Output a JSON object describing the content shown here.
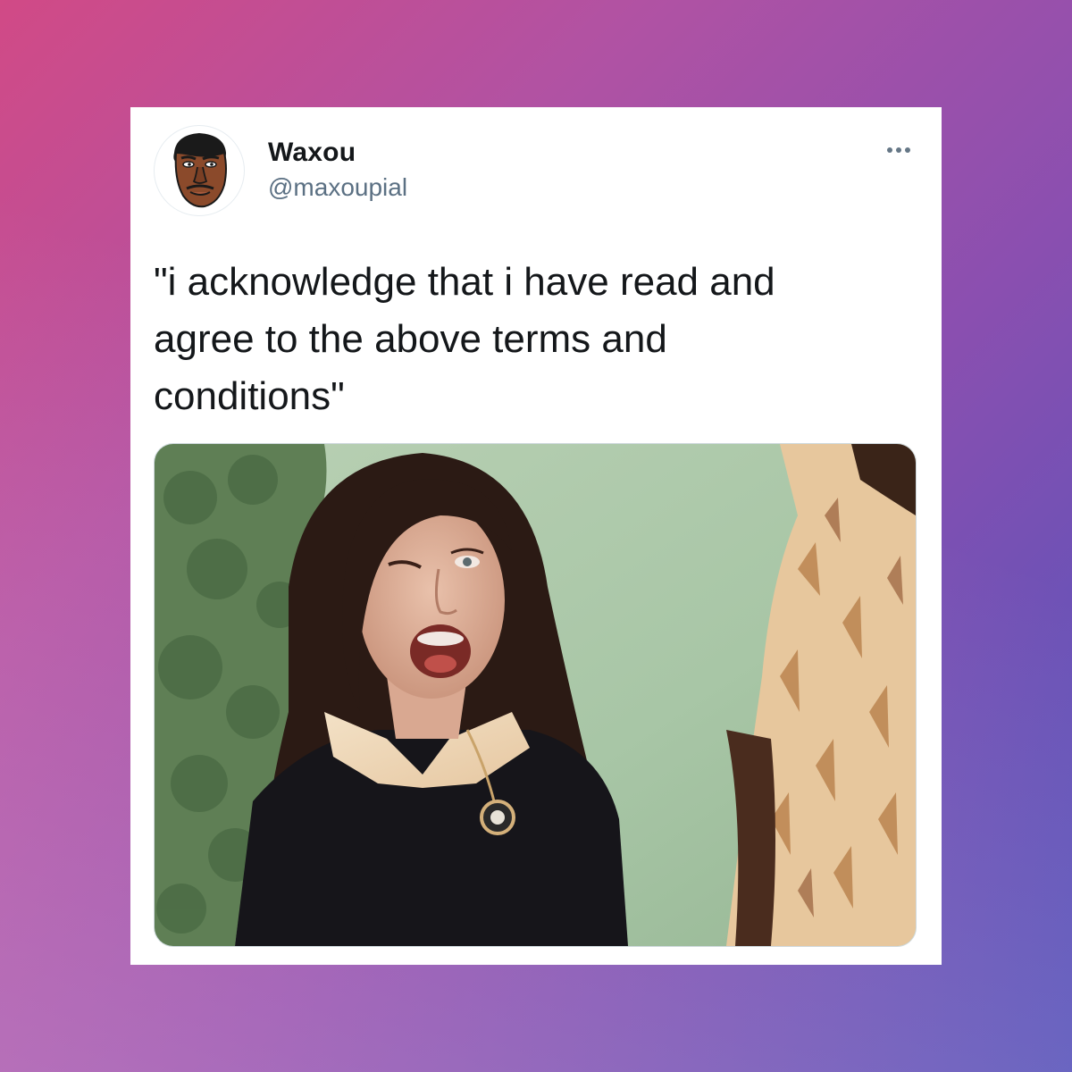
{
  "tweet": {
    "display_name": "Waxou",
    "handle": "@maxoupial",
    "text": "\"i acknowledge that i have read and\nagree to the above terms and\nconditions\"",
    "more_icon": "more-horizontal-icon",
    "avatar_icon": "cartoon-face-avatar"
  },
  "colors": {
    "background_start": "#d14a86",
    "background_end": "#4a55bd",
    "card": "#ffffff",
    "text_primary": "#14171a",
    "text_secondary": "#5b7083"
  }
}
